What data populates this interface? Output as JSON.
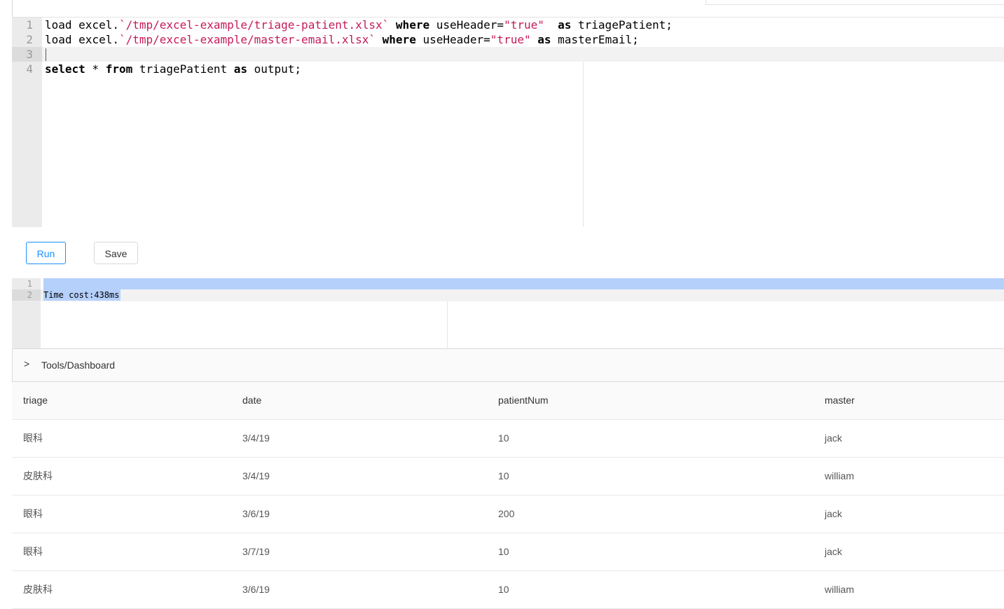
{
  "editor": {
    "lines": [
      {
        "number": "1",
        "segments": [
          {
            "t": "load excel.",
            "c": "plain"
          },
          {
            "t": "`/tmp/excel-example/triage-patient.xlsx`",
            "c": "str"
          },
          {
            "t": " ",
            "c": "plain"
          },
          {
            "t": "where",
            "c": "kw"
          },
          {
            "t": " useHeader=",
            "c": "plain"
          },
          {
            "t": "\"true\"",
            "c": "str"
          },
          {
            "t": "  ",
            "c": "plain"
          },
          {
            "t": "as",
            "c": "kw"
          },
          {
            "t": " triagePatient;",
            "c": "plain"
          }
        ]
      },
      {
        "number": "2",
        "segments": [
          {
            "t": "load excel.",
            "c": "plain"
          },
          {
            "t": "`/tmp/excel-example/master-email.xlsx`",
            "c": "str"
          },
          {
            "t": " ",
            "c": "plain"
          },
          {
            "t": "where",
            "c": "kw"
          },
          {
            "t": " useHeader=",
            "c": "plain"
          },
          {
            "t": "\"true\"",
            "c": "str"
          },
          {
            "t": " ",
            "c": "plain"
          },
          {
            "t": "as",
            "c": "kw"
          },
          {
            "t": " masterEmail;",
            "c": "plain"
          }
        ]
      },
      {
        "number": "3",
        "segments": []
      },
      {
        "number": "4",
        "segments": [
          {
            "t": "select",
            "c": "kw"
          },
          {
            "t": " * ",
            "c": "plain"
          },
          {
            "t": "from",
            "c": "kw"
          },
          {
            "t": " triagePatient ",
            "c": "plain"
          },
          {
            "t": "as",
            "c": "kw"
          },
          {
            "t": " output;",
            "c": "plain"
          }
        ]
      }
    ]
  },
  "buttons": {
    "run": "Run",
    "save": "Save"
  },
  "output": {
    "line1_number": "1",
    "line2_number": "2",
    "text": "Time cost:438ms"
  },
  "collapse": {
    "arrow": ">",
    "title": "Tools/Dashboard"
  },
  "table": {
    "columns": [
      "triage",
      "date",
      "patientNum",
      "master"
    ],
    "rows": [
      [
        "眼科",
        "3/4/19",
        "10",
        "jack"
      ],
      [
        "皮肤科",
        "3/4/19",
        "10",
        "william"
      ],
      [
        "眼科",
        "3/6/19",
        "200",
        "jack"
      ],
      [
        "眼科",
        "3/7/19",
        "10",
        "jack"
      ],
      [
        "皮肤科",
        "3/6/19",
        "10",
        "william"
      ]
    ]
  }
}
